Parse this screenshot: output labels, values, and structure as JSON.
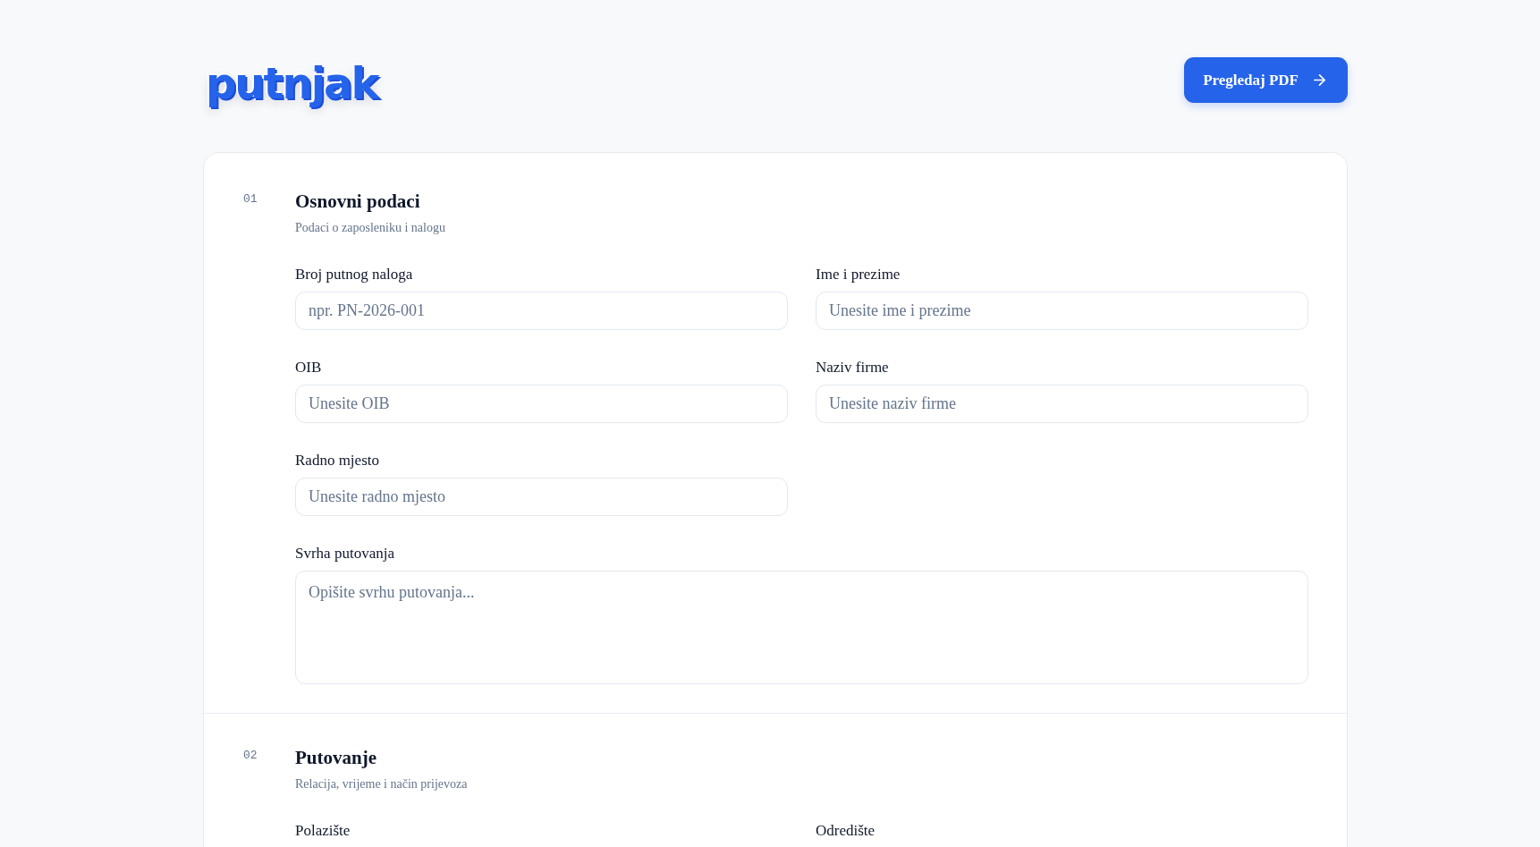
{
  "header": {
    "logo": "putnjak",
    "preview_button": {
      "label": "Pregledaj PDF"
    }
  },
  "sections": [
    {
      "number": "01",
      "title": "Osnovni podaci",
      "subtitle": "Podaci o zaposleniku i nalogu",
      "fields": [
        {
          "kind": "input",
          "label": "Broj putnog naloga",
          "placeholder": "npr. PN-2026-001"
        },
        {
          "kind": "input",
          "label": "Ime i prezime",
          "placeholder": "Unesite ime i prezime"
        },
        {
          "kind": "input",
          "label": "OIB",
          "placeholder": "Unesite OIB"
        },
        {
          "kind": "input",
          "label": "Naziv firme",
          "placeholder": "Unesite naziv firme"
        },
        {
          "kind": "input",
          "label": "Radno mjesto",
          "placeholder": "Unesite radno mjesto"
        },
        {
          "kind": "textarea",
          "label": "Svrha putovanja",
          "placeholder": "Opišite svrhu putovanja..."
        }
      ]
    },
    {
      "number": "02",
      "title": "Putovanje",
      "subtitle": "Relacija, vrijeme i način prijevoza",
      "fields": [
        {
          "kind": "input",
          "label": "Polazište"
        },
        {
          "kind": "input",
          "label": "Odredište"
        }
      ]
    }
  ]
}
